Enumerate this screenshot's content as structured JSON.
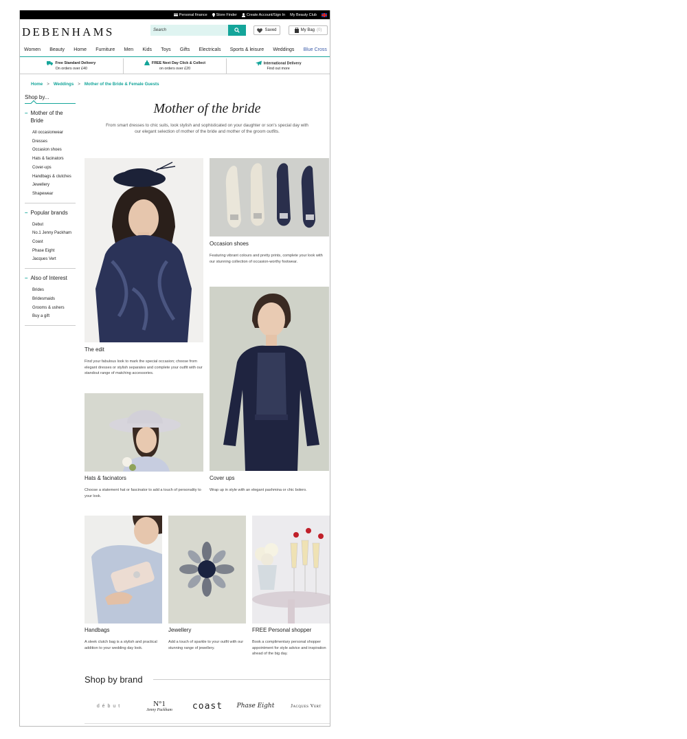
{
  "topbar": {
    "personal_finance": "Personal finance",
    "store_finder": "Store Finder",
    "account": "Create Account/Sign In",
    "beauty_club": "My Beauty Club"
  },
  "header": {
    "logo": "DEBENHAMS",
    "search_placeholder": "Search",
    "saved_label": "Saved",
    "bag_label": "My Bag",
    "bag_count": "(0)"
  },
  "nav": [
    "Women",
    "Beauty",
    "Home",
    "Furniture",
    "Men",
    "Kids",
    "Toys",
    "Gifts",
    "Electricals",
    "Sports & leisure",
    "Weddings",
    "Blue Cross"
  ],
  "delivery": [
    {
      "title": "Free Standard Delivery",
      "sub": "On orders over £40"
    },
    {
      "title": "FREE Next Day Click & Collect",
      "sub": "on orders over £20"
    },
    {
      "title": "International Delivery",
      "sub": "Find out more"
    }
  ],
  "breadcrumb": [
    "Home",
    "Weddings",
    "Mother of the Bride & Female Guests"
  ],
  "sidebar": {
    "shop_by": "Shop by...",
    "groups": [
      {
        "title": "Mother of the Bride",
        "items": [
          "All occasionwear",
          "Dresses",
          "Occasion shoes",
          "Hats & facinators",
          "Cover-ups",
          "Handbags & clutches",
          "Jewellery",
          "Shapewear"
        ]
      },
      {
        "title": "Popular brands",
        "items": [
          "Debut",
          "No.1 Jenny Packham",
          "Coast",
          "Phase Eight",
          "Jacques Vert"
        ]
      },
      {
        "title": "Also of Interest",
        "items": [
          "Brides",
          "Bridesmaids",
          "Grooms & ushers",
          "Buy a gift"
        ]
      }
    ]
  },
  "main": {
    "title": "Mother of the bride",
    "intro": "From smart dresses to chic suits, look stylish and sophisticated on your daughter or son's special day with our elegant selection of mother of the bride and mother of the groom outfits.",
    "tiles": [
      {
        "caption": "The edit",
        "desc": "Find your fabulous look to mark the special occasion; choose from elegant dresses or stylish separates and complete your outfit with our standout range of matching accessories."
      },
      {
        "caption": "Occasion shoes",
        "desc": "Featuring vibrant colours and pretty prints, complete your look with our stunning collection of occasion-worthy footwear."
      },
      {
        "caption": "Hats & facinators",
        "desc": "Choose a statement hat or fascinator to add a touch of personality to your look."
      },
      {
        "caption": "Cover ups",
        "desc": "Wrap up in style with an elegant pashmina or chic bolero."
      },
      {
        "caption": "Handbags",
        "desc": "A sleek clutch bag is a stylish and practical addition to your wedding day look."
      },
      {
        "caption": "Jewellery",
        "desc": "Add a touch of sparkle to your outfit with our stunning range of jewellery."
      },
      {
        "caption": "FREE Personal shopper",
        "desc": "Book a complimentary personal shopper appointment for style advice and inspiration ahead of the big day."
      }
    ],
    "brand_heading": "Shop by brand",
    "brands": {
      "debut": "d é b u t",
      "no1_top": "N°1",
      "no1_sub": "Jenny Packham",
      "coast": "coast",
      "phase": "Phase Eight",
      "jacques": "Jacques Vert"
    }
  },
  "colors": {
    "accent": "#14a59a",
    "blue_cross": "#3a5ba9",
    "navy": "#1f2440"
  }
}
